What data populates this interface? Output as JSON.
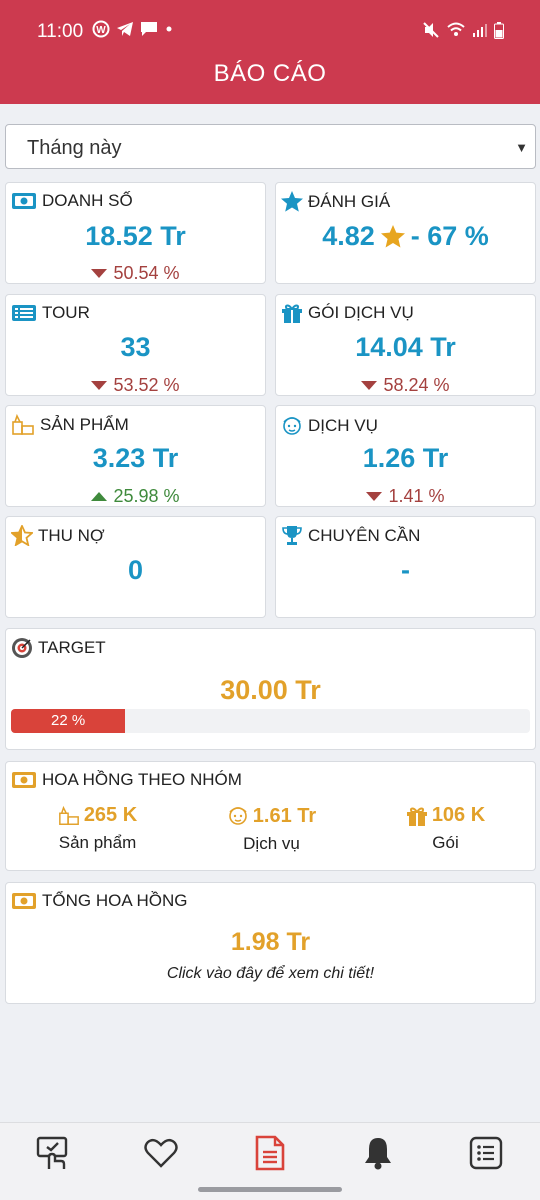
{
  "status_bar": {
    "time": "11:00"
  },
  "header": {
    "title": "BÁO CÁO"
  },
  "period_select": {
    "value": "Tháng này"
  },
  "cards": {
    "doanh_so": {
      "label": "DOANH SỐ",
      "value": "18.52 Tr",
      "change": "50.54 %",
      "direction": "down"
    },
    "danh_gia": {
      "label": "ĐÁNH GIÁ",
      "value": "4.82",
      "value_suffix": "- 67 %"
    },
    "tour": {
      "label": "TOUR",
      "value": "33",
      "change": "53.52 %",
      "direction": "down"
    },
    "goi_dich_vu": {
      "label": "GÓI DỊCH VỤ",
      "value": "14.04 Tr",
      "change": "58.24 %",
      "direction": "down"
    },
    "san_pham": {
      "label": "SẢN PHẨM",
      "value": "3.23 Tr",
      "change": "25.98 %",
      "direction": "up"
    },
    "dich_vu": {
      "label": "DỊCH VỤ",
      "value": "1.26 Tr",
      "change": "1.41 %",
      "direction": "down"
    },
    "thu_no": {
      "label": "THU NỢ",
      "value": "0"
    },
    "chuyen_can": {
      "label": "CHUYÊN CẦN",
      "value": "-"
    }
  },
  "target": {
    "label": "TARGET",
    "value": "30.00 Tr",
    "progress_label": "22 %",
    "progress_fraction": 0.22
  },
  "commission_group": {
    "label": "HOA HỒNG THEO NHÓM",
    "items": [
      {
        "value": "265 K",
        "label": "Sản phẩm",
        "icon": "product-icon"
      },
      {
        "value": "1.61 Tr",
        "label": "Dịch vụ",
        "icon": "service-icon"
      },
      {
        "value": "106 K",
        "label": "Gói",
        "icon": "gift-icon"
      }
    ]
  },
  "total_commission": {
    "label": "TỔNG HOA HỒNG",
    "value": "1.98 Tr",
    "hint": "Click vào đây để xem chi tiết!"
  },
  "colors": {
    "header": "#cc3a4f",
    "value_blue": "#1a94c4",
    "value_orange": "#e2a12a",
    "down": "#a4413f",
    "up": "#3f8a3c",
    "progress": "#d9433a"
  },
  "bottom_nav": [
    {
      "icon": "checkin-icon"
    },
    {
      "icon": "heart-icon"
    },
    {
      "icon": "report-icon",
      "active": true
    },
    {
      "icon": "bell-icon"
    },
    {
      "icon": "list-icon"
    }
  ]
}
